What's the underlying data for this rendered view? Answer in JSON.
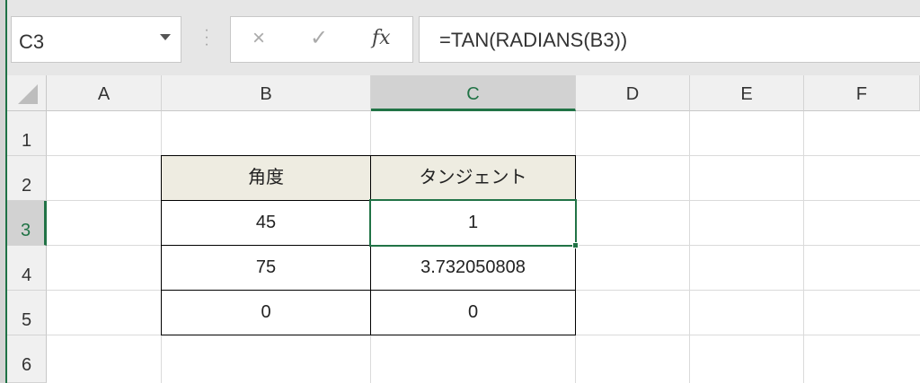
{
  "name_box": {
    "value": "C3"
  },
  "formula_bar": {
    "cancel_icon": "×",
    "enter_icon": "✓",
    "fx_label": "fx",
    "formula": "=TAN(RADIANS(B3))"
  },
  "columns": [
    "A",
    "B",
    "C",
    "D",
    "E",
    "F"
  ],
  "rows": [
    "1",
    "2",
    "3",
    "4",
    "5",
    "6"
  ],
  "selected_cell": "C3",
  "table": {
    "headers": [
      "角度",
      "タンジェント"
    ],
    "rows": [
      [
        "45",
        "1"
      ],
      [
        "75",
        "3.732050808"
      ],
      [
        "0",
        "0"
      ]
    ]
  },
  "colors": {
    "accent": "#217346",
    "header_fill": "#eeece1"
  }
}
